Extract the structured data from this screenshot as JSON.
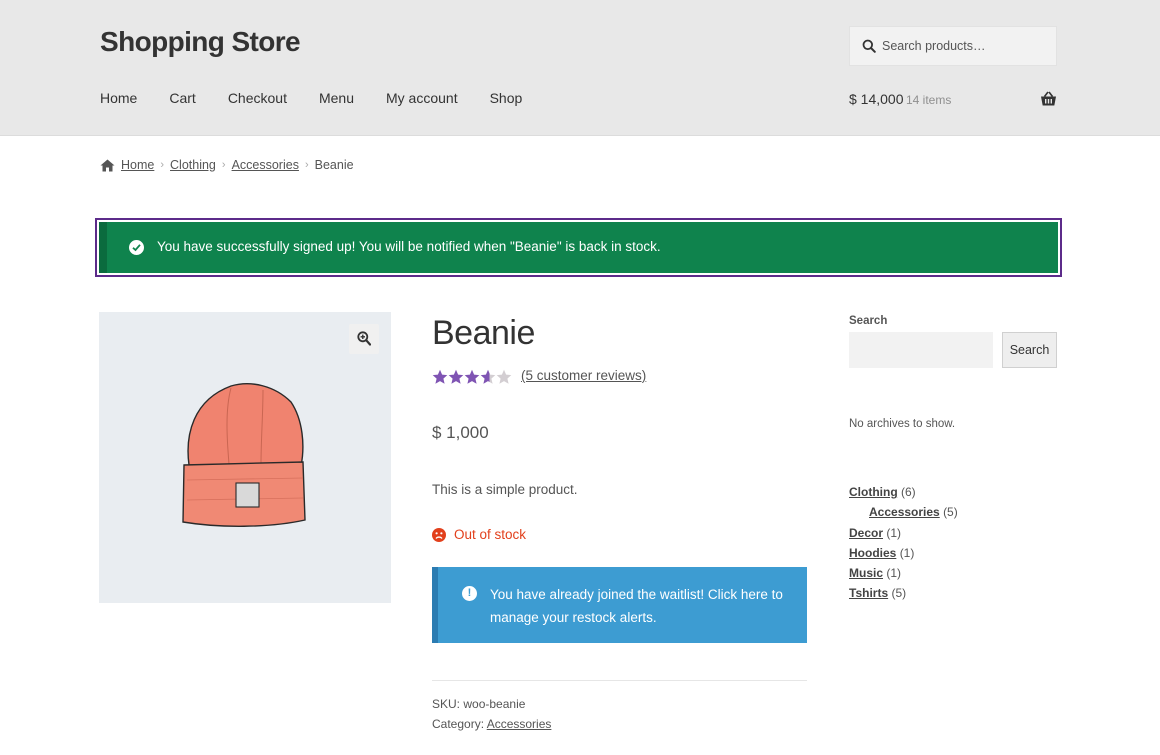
{
  "header": {
    "site_title": "Shopping Store",
    "search_placeholder": "Search products…",
    "nav": [
      "Home",
      "Cart",
      "Checkout",
      "Menu",
      "My account",
      "Shop"
    ],
    "cart_amount": "$ 14,000",
    "cart_count": "14 items"
  },
  "breadcrumb": {
    "items": [
      "Home",
      "Clothing",
      "Accessories"
    ],
    "current": "Beanie"
  },
  "notice": {
    "text": "You have successfully signed up! You will be notified when \"Beanie\" is back in stock."
  },
  "product": {
    "title": "Beanie",
    "rating": 3.6,
    "rating_max": 5,
    "reviews_link": "(5 customer reviews)",
    "price": "$ 1,000",
    "description": "This is a simple product.",
    "stock_status": "Out of stock",
    "waitlist_message": "You have already joined the waitlist! Click here to manage your restock alerts.",
    "sku_label": "SKU:",
    "sku": "woo-beanie",
    "category_label": "Category:",
    "category": "Accessories"
  },
  "sidebar": {
    "search_label": "Search",
    "search_button": "Search",
    "archives_text": "No archives to show.",
    "categories": [
      {
        "name": "Clothing",
        "count": "(6)",
        "sub": false
      },
      {
        "name": "Accessories",
        "count": "(5)",
        "sub": true
      },
      {
        "name": "Decor",
        "count": "(1)",
        "sub": false
      },
      {
        "name": "Hoodies",
        "count": "(1)",
        "sub": false
      },
      {
        "name": "Music",
        "count": "(1)",
        "sub": false
      },
      {
        "name": "Tshirts",
        "count": "(5)",
        "sub": false
      }
    ]
  },
  "colors": {
    "header_bg": "#e8e8e8",
    "success": "#0f834d",
    "focus_outline": "#5c2b8a",
    "info": "#3d9cd2",
    "star": "#7f54b3",
    "out_of_stock": "#e2401c"
  }
}
